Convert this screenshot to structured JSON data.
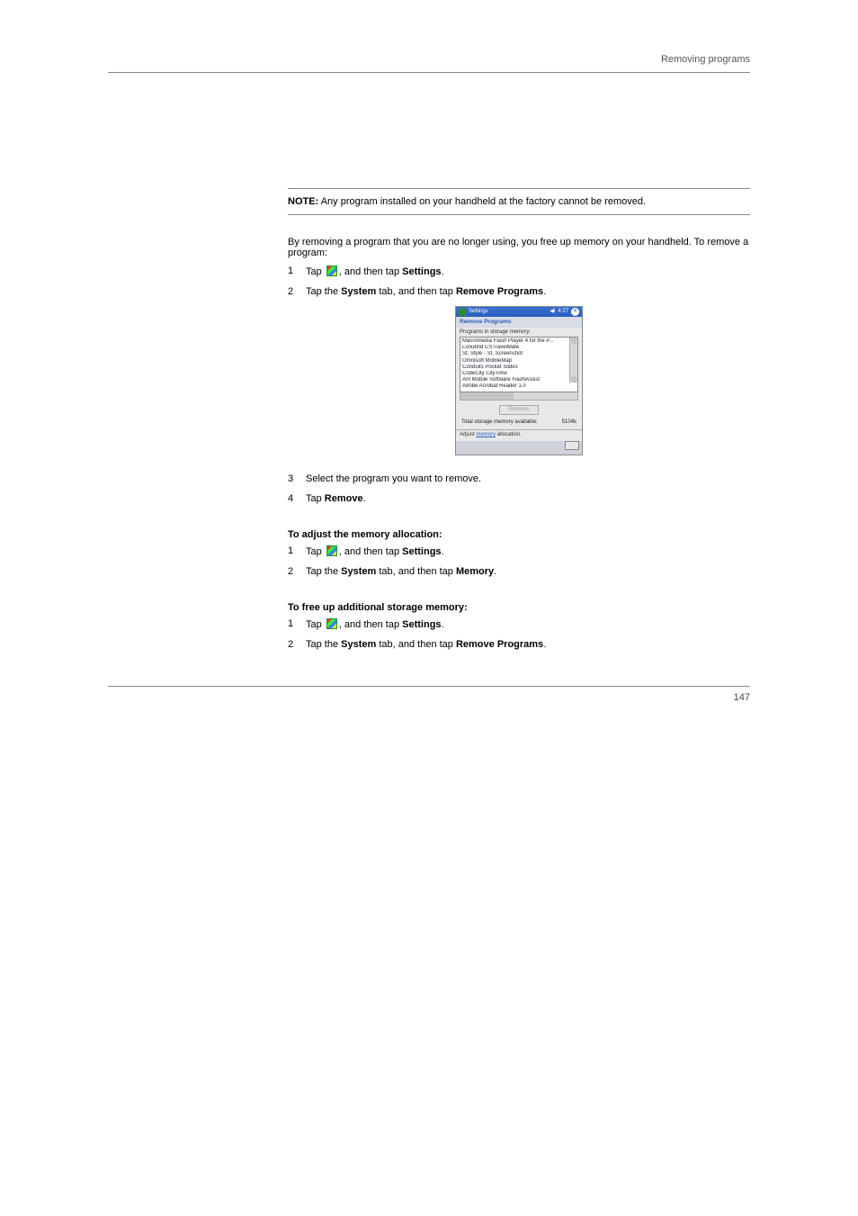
{
  "running_header": "Removing programs",
  "note": {
    "label": "NOTE:",
    "text": "Any program installed on your handheld at the factory cannot be removed."
  },
  "intro": "By removing a program that you are no longer using, you free up memory on your handheld. To remove a program:",
  "steps_a": [
    "Tap , and then tap Settings.",
    "Tap the System tab, and then tap Remove Programs."
  ],
  "device": {
    "titlebar": {
      "title": "Settings",
      "signal": "⁞",
      "sound_icon": "sound-icon",
      "time": "4:27",
      "ok": "ok"
    },
    "caption": "Remove Programs",
    "list_label": "Programs in storage memory:",
    "programs": [
      "Macromedia Flash Player 4 for the P...",
      "Lonubrid CSTravelMate",
      "St. Style - St. Screenshot",
      "Omnisoft MobileMap",
      "Conduits Pocket Slides",
      "CodeCity CityTime",
      "Ant Mobile Software FlashAssist",
      "Adobe Acrobat Reader 1.0"
    ],
    "remove_btn": "Remove",
    "mem_label": "Total storage memory available:",
    "mem_value": "5104k",
    "adjust_prefix": "Adjust ",
    "adjust_link": "memory",
    "adjust_suffix": " allocation."
  },
  "step3": "Select the program you want to remove.",
  "step4": "Tap Remove.",
  "heading_b": "To adjust the memory allocation:",
  "steps_b": [
    "Tap , and then tap Settings.",
    "Tap the System tab, and then tap Memory."
  ],
  "heading_c": "To free up additional storage memory:",
  "steps_c": [
    "Tap , and then tap Settings.",
    "Tap the System tab, and then tap Remove Programs."
  ],
  "page_number": "147"
}
